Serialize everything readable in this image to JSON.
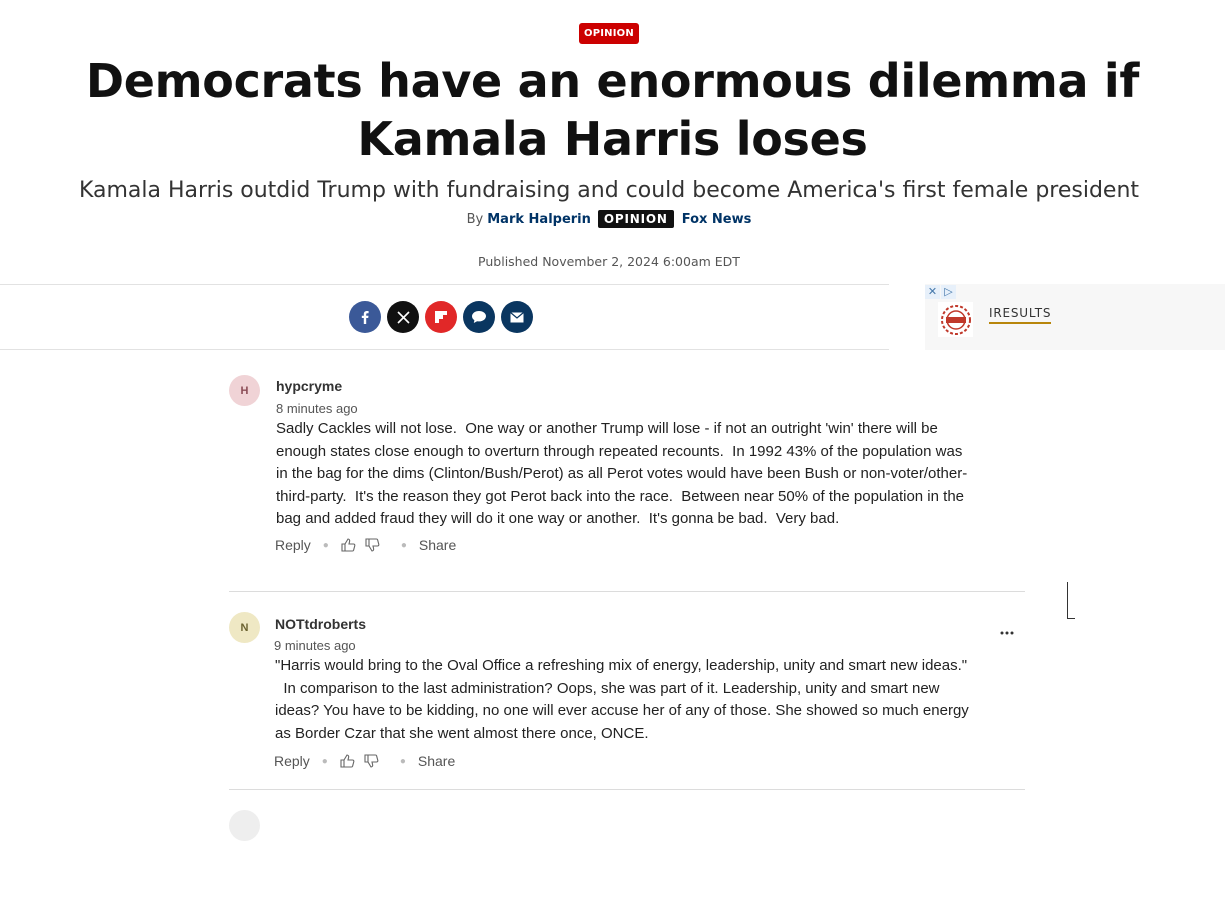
{
  "article": {
    "category_badge": "OPINION",
    "headline": "Democrats have an enormous dilemma if Kamala Harris loses",
    "subheadline": "Kamala Harris outdid Trump with fundraising and could become America's first female president",
    "byline": {
      "by": "By",
      "author": "Mark Halperin",
      "tag": "OPINION",
      "outlet": "Fox News"
    },
    "published": "Published November 2, 2024 6:00am EDT"
  },
  "share": {
    "icons": [
      "facebook-icon",
      "x-icon",
      "flipboard-icon",
      "comments-icon",
      "email-icon"
    ]
  },
  "ad": {
    "controls": [
      "✕",
      "▷"
    ],
    "label": "IRESULTS"
  },
  "comments": [
    {
      "initial": "H",
      "username": "hypcryme",
      "time": "8 minutes ago",
      "lines": [
        "Sadly Cackles will not lose.  One way or another Trump will lose - if not an outright 'win' there will be",
        "enough states close enough to overturn through repeated recounts.  In 1992 43% of the population was",
        "in the bag for the dims (Clinton/Bush/Perot) as all Perot votes would have been Bush or non-voter/other-",
        "third-party.  It's the reason they got Perot back into the race.  Between near 50% of the population in the",
        "bag and added fraud they will do it one way or another.  It's gonna be bad.  Very bad."
      ],
      "reply_label": "Reply",
      "share_label": "Share"
    },
    {
      "initial": "N",
      "username": "NOTtdroberts",
      "time": "9 minutes ago",
      "lines": [
        "\"Harris would bring to the Oval Office a refreshing mix of energy, leadership, unity and smart new ideas.\"",
        "  In comparison to the last administration? Oops, she was part of it. Leadership, unity and smart new",
        "ideas? You have to be kidding, no one will ever accuse her of any of those. She showed so much energy",
        "as Border Czar that she went almost there once, ONCE."
      ],
      "reply_label": "Reply",
      "share_label": "Share"
    }
  ],
  "colors": {
    "opinion_red": "#cc0000",
    "link_navy": "#003366",
    "facebook": "#3b5998",
    "flipboard": "#e12828"
  }
}
